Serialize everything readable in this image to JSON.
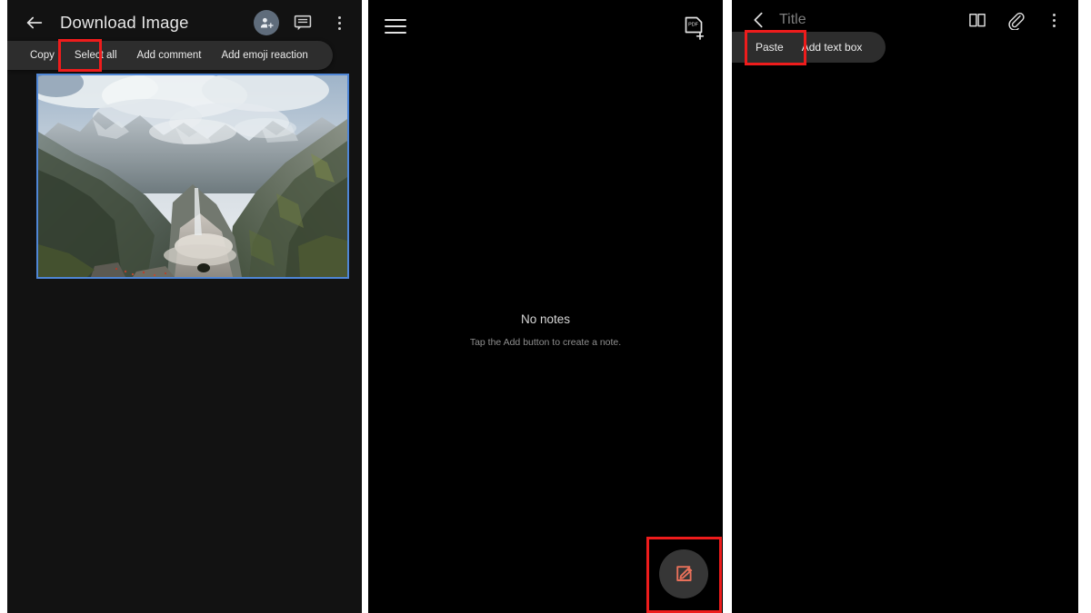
{
  "panels": [
    {
      "id": "docs-image-selected",
      "appbar": {
        "back_icon": "arrow-back-icon",
        "title": "Download Image",
        "actions": [
          {
            "icon": "person-add-icon",
            "name": "add-people-button"
          },
          {
            "icon": "comment-icon",
            "name": "comments-button"
          },
          {
            "icon": "kebab-menu-icon",
            "name": "overflow-menu-button"
          }
        ]
      },
      "context_menu": {
        "items": [
          "Copy",
          "Select all",
          "Add comment",
          "Add emoji reaction"
        ],
        "highlighted": "Copy"
      },
      "content": {
        "image_alt": "Mountain valley landscape with clouds",
        "selected": true,
        "selection_color": "#4f86d6"
      }
    },
    {
      "id": "notes-empty",
      "appbar": {
        "menu_icon": "hamburger-menu-icon",
        "action_icon": "import-pdf-icon"
      },
      "empty_state": {
        "title": "No notes",
        "subtitle": "Tap the Add button to create a note."
      },
      "fab": {
        "icon": "compose-note-icon",
        "color": "#e8705a",
        "highlighted": true
      }
    },
    {
      "id": "note-editor",
      "appbar": {
        "back_icon": "chevron-back-icon",
        "title_placeholder": "Title",
        "actions": [
          {
            "icon": "book-icon",
            "name": "reading-mode-button"
          },
          {
            "icon": "paperclip-icon",
            "name": "attachment-button"
          },
          {
            "icon": "kebab-menu-icon",
            "name": "overflow-menu-button"
          }
        ]
      },
      "context_menu": {
        "items": [
          "Paste",
          "Add text box"
        ],
        "highlighted": "Paste"
      }
    }
  ],
  "colors": {
    "highlight_box": "#ee1c1c",
    "panel1_bg": "#121212",
    "panel2_bg": "#000000",
    "menu_bg": "#2d2d2d",
    "fab_bg": "#363636",
    "fab_icon": "#e8705a",
    "avatar_bg": "#5f6c7b"
  }
}
